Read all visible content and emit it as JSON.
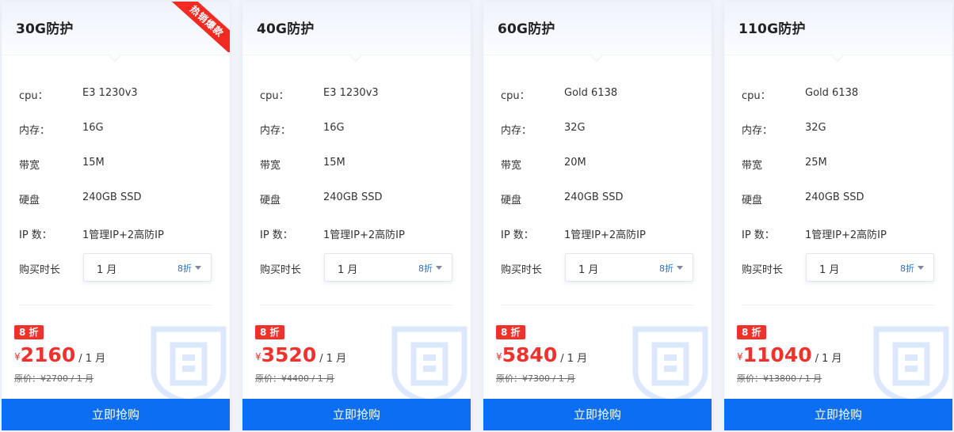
{
  "labels": {
    "cpu": "cpu：",
    "memory": "内存：",
    "bandwidth": "带宽",
    "disk": "硬盘",
    "ip": "IP 数：",
    "period": "购买时长",
    "buy": "立即抢购",
    "orig_prefix": "原价：",
    "yen": "¥"
  },
  "ribbon": "热销爆款",
  "colors": {
    "accent": "#0c6ff2",
    "price": "#f0312c",
    "ribbon": "#f22a22"
  },
  "cards": [
    {
      "title": "30G防护",
      "cpu": "E3 1230v3",
      "memory": "16G",
      "bandwidth": "15M",
      "disk": "240GB SSD",
      "ip": "1管理IP+2高防IP",
      "period": "1 月",
      "period_discount": "8折",
      "badge": "8 折",
      "price": "2160",
      "unit": "/ 1 月",
      "orig": "原价：¥2700 / 1 月"
    },
    {
      "title": "40G防护",
      "cpu": "E3 1230v3",
      "memory": "16G",
      "bandwidth": "15M",
      "disk": "240GB SSD",
      "ip": "1管理IP+2高防IP",
      "period": "1 月",
      "period_discount": "8折",
      "badge": "8 折",
      "price": "3520",
      "unit": "/ 1 月",
      "orig": "原价：¥4400 / 1 月"
    },
    {
      "title": "60G防护",
      "cpu": "Gold 6138",
      "memory": "32G",
      "bandwidth": "20M",
      "disk": "240GB SSD",
      "ip": "1管理IP+2高防IP",
      "period": "1 月",
      "period_discount": "8折",
      "badge": "8 折",
      "price": "5840",
      "unit": "/ 1 月",
      "orig": "原价：¥7300 / 1 月"
    },
    {
      "title": "110G防护",
      "cpu": "Gold 6138",
      "memory": "32G",
      "bandwidth": "25M",
      "disk": "240GB SSD",
      "ip": "1管理IP+2高防IP",
      "period": "1 月",
      "period_discount": "8折",
      "badge": "8 折",
      "price": "11040",
      "unit": "/ 1 月",
      "orig": "原价：¥13800 / 1 月"
    }
  ]
}
